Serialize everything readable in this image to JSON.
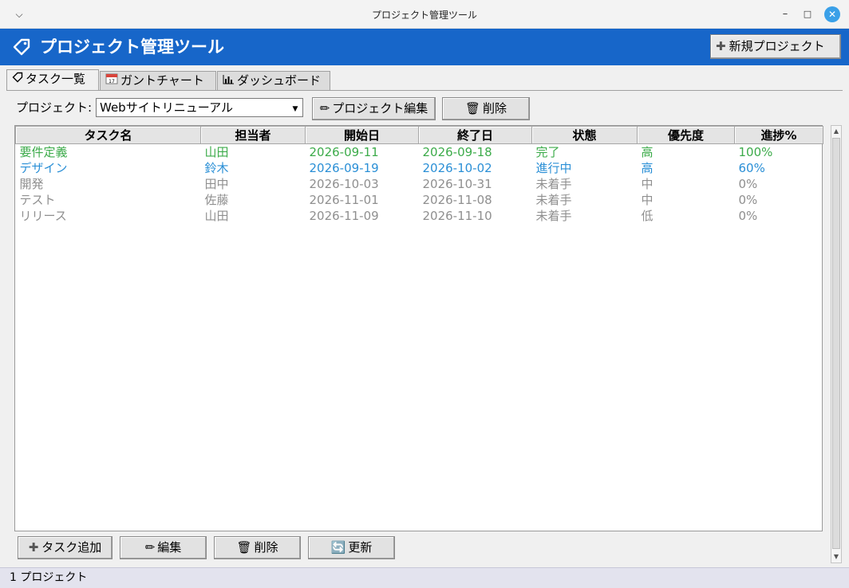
{
  "window": {
    "title": "プロジェクト管理ツール"
  },
  "header": {
    "title": "プロジェクト管理ツール",
    "new_project_label": "新規プロジェクト"
  },
  "tabs": [
    {
      "label": "タスク一覧",
      "icon": "tag-icon"
    },
    {
      "label": "ガントチャート",
      "icon": "calendar-icon"
    },
    {
      "label": "ダッシュボード",
      "icon": "bar-chart-icon"
    }
  ],
  "project": {
    "label": "プロジェクト:",
    "selected": "Webサイトリニューアル",
    "edit_label": "プロジェクト編集",
    "delete_label": "削除"
  },
  "table": {
    "columns": [
      "タスク名",
      "担当者",
      "開始日",
      "終了日",
      "状態",
      "優先度",
      "進捗%"
    ],
    "rows": [
      {
        "cells": [
          "要件定義",
          "山田",
          "2026-09-11",
          "2026-09-18",
          "完了",
          "高",
          "100%"
        ],
        "color": "#3cab4a"
      },
      {
        "cells": [
          "デザイン",
          "鈴木",
          "2026-09-19",
          "2026-10-02",
          "進行中",
          "高",
          "60%"
        ],
        "color": "#2a8fd6"
      },
      {
        "cells": [
          "開発",
          "田中",
          "2026-10-03",
          "2026-10-31",
          "未着手",
          "中",
          "0%"
        ],
        "color": "#8f8f8f"
      },
      {
        "cells": [
          "テスト",
          "佐藤",
          "2026-11-01",
          "2026-11-08",
          "未着手",
          "中",
          "0%"
        ],
        "color": "#8f8f8f"
      },
      {
        "cells": [
          "リリース",
          "山田",
          "2026-11-09",
          "2026-11-10",
          "未着手",
          "低",
          "0%"
        ],
        "color": "#8f8f8f"
      }
    ]
  },
  "actions": {
    "add_task": "タスク追加",
    "edit": "編集",
    "delete": "削除",
    "refresh": "更新"
  },
  "status": {
    "text": "1 プロジェクト"
  },
  "colors": {
    "header_bg": "#1766c9",
    "done": "#3cab4a",
    "in_progress": "#2a8fd6",
    "not_started": "#8f8f8f"
  }
}
